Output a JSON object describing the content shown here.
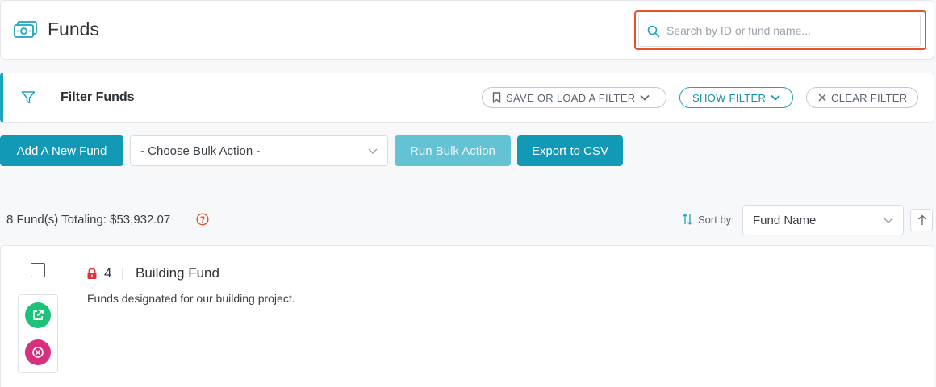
{
  "header": {
    "title": "Funds",
    "icon": "money-icon",
    "search": {
      "placeholder": "Search by ID or fund name...",
      "value": ""
    }
  },
  "filter": {
    "title": "Filter Funds",
    "save_load_label": "SAVE OR LOAD A FILTER",
    "show_label": "SHOW FILTER",
    "clear_label": "CLEAR FILTER"
  },
  "actions": {
    "add_label": "Add A New Fund",
    "bulk_select_value": "- Choose Bulk Action -",
    "run_label": "Run Bulk Action",
    "export_label": "Export to CSV"
  },
  "summary": {
    "text": "8 Fund(s) Totaling: $53,932.07",
    "sort_label": "Sort by:",
    "sort_value": "Fund Name"
  },
  "funds": [
    {
      "id": "4",
      "separator": "|",
      "name": "Building Fund",
      "description": "Funds designated for our building project.",
      "locked": true
    }
  ],
  "colors": {
    "accent": "#1199b6",
    "highlight": "#e6532b",
    "open": "#1dc27a",
    "delete": "#d6317c",
    "lock": "#e0303a"
  }
}
